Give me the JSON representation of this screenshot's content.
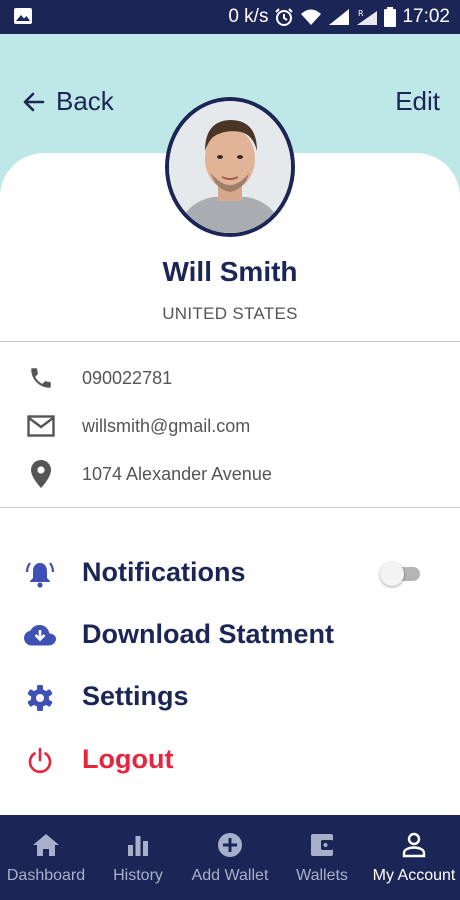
{
  "status_bar": {
    "speed": "0 k/s",
    "time": "17:02"
  },
  "header": {
    "back_label": "Back",
    "edit_label": "Edit"
  },
  "profile": {
    "name": "Will Smith",
    "country": "UNITED STATES"
  },
  "contact": {
    "phone": "090022781",
    "email": "willsmith@gmail.com",
    "address": "1074  Alexander Avenue"
  },
  "menu": {
    "notifications": "Notifications",
    "notifications_enabled": false,
    "download": "Download Statment",
    "settings": "Settings",
    "logout": "Logout"
  },
  "bottom_nav": {
    "items": [
      {
        "label": "Dashboard",
        "icon": "home-icon"
      },
      {
        "label": "History",
        "icon": "bar-chart-icon"
      },
      {
        "label": "Add Wallet",
        "icon": "plus-circle-icon"
      },
      {
        "label": "Wallets",
        "icon": "wallet-icon"
      },
      {
        "label": "My Account",
        "icon": "person-icon"
      }
    ],
    "active": "My Account"
  },
  "colors": {
    "navy": "#1b2656",
    "header_teal": "#bde8e7",
    "accent_blue": "#3f51b5",
    "logout_red": "#e8233d"
  }
}
